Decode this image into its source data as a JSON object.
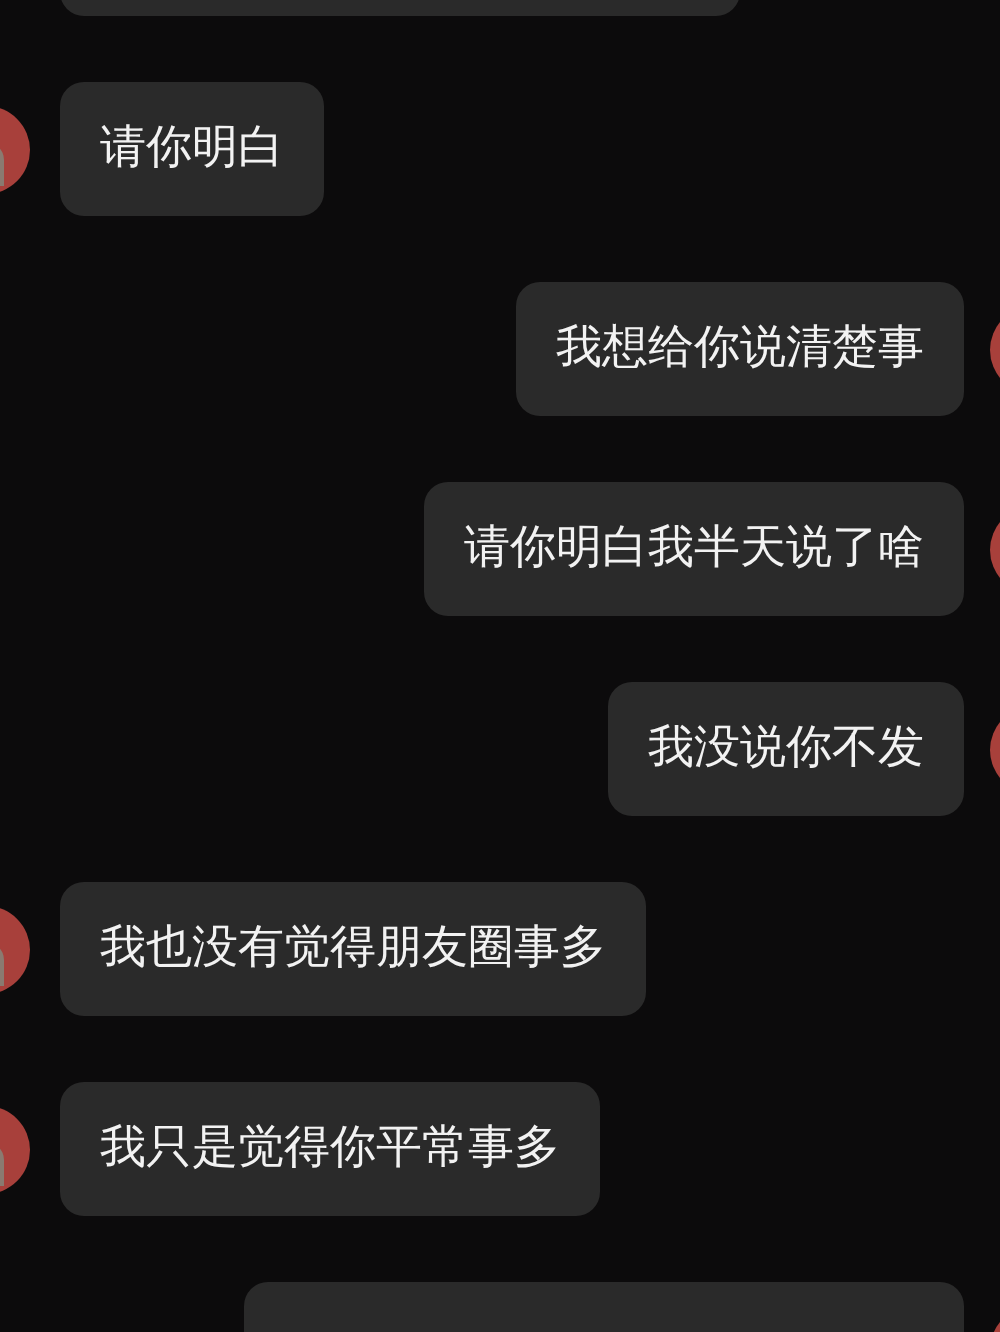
{
  "messages": [
    {
      "kind": "received"
    },
    {
      "kind": "received",
      "text": "请你明白"
    },
    {
      "kind": "sent",
      "text": "我想给你说清楚事"
    },
    {
      "kind": "sent",
      "text": "请你明白我半天说了啥"
    },
    {
      "kind": "sent",
      "text": "我没说你不发"
    },
    {
      "kind": "received",
      "text": "我也没有觉得朋友圈事多"
    },
    {
      "kind": "received",
      "text": "我只是觉得你平常事多"
    },
    {
      "kind": "sent"
    }
  ]
}
